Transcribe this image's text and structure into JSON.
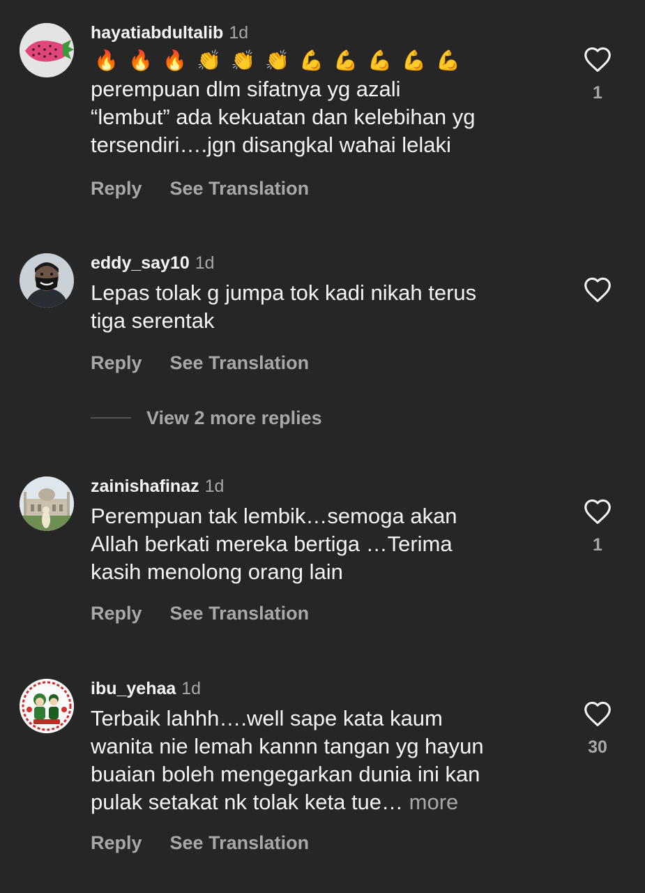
{
  "comments": [
    {
      "username": "hayatiabdultalib",
      "time": "1d",
      "emojis": [
        "🔥",
        "🔥",
        "🔥",
        "👏",
        "👏",
        "👏",
        "💪",
        "💪",
        "💪",
        "💪",
        "💪"
      ],
      "lines": [
        "perempuan dlm sifatnya yg azali",
        "“lembut” ada kekuatan dan kelebihan yg",
        "tersendiri….jgn disangkal wahai lelaki"
      ],
      "reply_label": "Reply",
      "translate_label": "See Translation",
      "like_count": "1",
      "avatar_icon": "strawberry-icon"
    },
    {
      "username": "eddy_say10",
      "time": "1d",
      "lines": [
        "Lepas tolak  g jumpa tok kadi nikah terus",
        "tiga serentak"
      ],
      "reply_label": "Reply",
      "translate_label": "See Translation",
      "like_count": "",
      "avatar_icon": "masked-person-icon"
    },
    {
      "username": "zainishafinaz",
      "time": "1d",
      "lines": [
        "Perempuan tak lembik…semoga akan",
        "Allah berkati mereka bertiga …Terima",
        "kasih menolong orang lain"
      ],
      "reply_label": "Reply",
      "translate_label": "See Translation",
      "like_count": "1",
      "avatar_icon": "mosque-photo-icon"
    },
    {
      "username": "ibu_yehaa",
      "time": "1d",
      "lines": [
        "Terbaik lahhh….well sape kata kaum",
        "wanita nie lemah kannn tangan yg hayun",
        "buaian boleh mengegarkan dunia ini kan",
        "pulak setakat nk tolak keta tue…"
      ],
      "more_label": "more",
      "reply_label": "Reply",
      "translate_label": "See Translation",
      "like_count": "30",
      "avatar_icon": "cartoon-couple-icon"
    }
  ],
  "view_replies_label": "View 2 more replies",
  "colors": {
    "background": "#262626",
    "primary_text": "#f5f5f5",
    "secondary_text": "#a8a8a8"
  }
}
